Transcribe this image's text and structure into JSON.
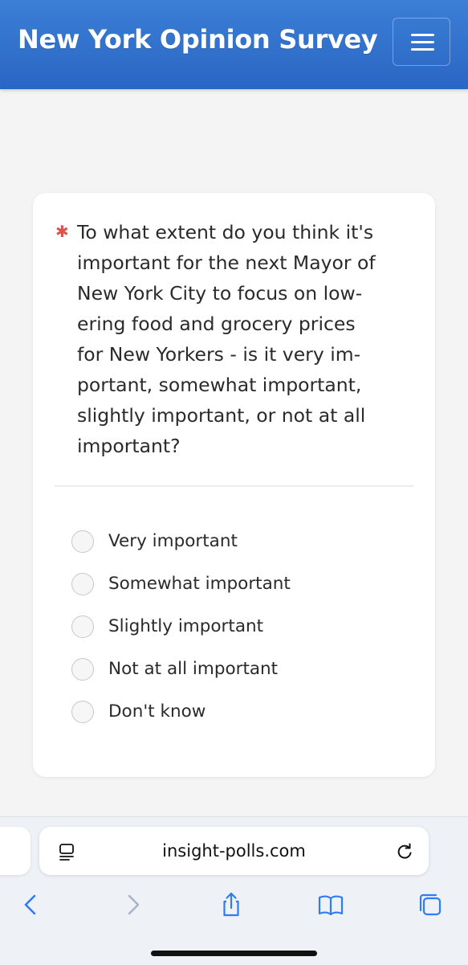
{
  "header": {
    "title": "New York Opinion Survey",
    "menu_icon": "hamburger-menu-icon"
  },
  "question": {
    "required_marker": "✱",
    "text": "To what extent do you think it's important for the next Mayor of New York City to focus on low-ering food and grocery prices for New Yorkers - is it very im-portant, somewhat important, slightly important, or not at all important?",
    "lines": [
      "To what extent do you think it's",
      "important for the next Mayor of",
      "New York City to focus on low-",
      "ering food and grocery prices",
      "for New Yorkers - is it very im-",
      "portant, somewhat important,",
      "slightly important, or not at all",
      "important?"
    ],
    "options": [
      {
        "label": "Very important",
        "selected": false
      },
      {
        "label": "Somewhat important",
        "selected": false
      },
      {
        "label": "Slightly important",
        "selected": false
      },
      {
        "label": "Not at all important",
        "selected": false
      },
      {
        "label": "Don't know",
        "selected": false
      }
    ]
  },
  "browser": {
    "url": "insight-polls.com",
    "icons": [
      "page-menu-icon",
      "reload-icon",
      "back-icon",
      "forward-icon",
      "share-icon",
      "bookmarks-icon",
      "tabs-icon"
    ]
  },
  "colors": {
    "header_blue": "#2f6fcf",
    "required_red": "#d9534f",
    "ios_blue": "#2f7cf6"
  }
}
